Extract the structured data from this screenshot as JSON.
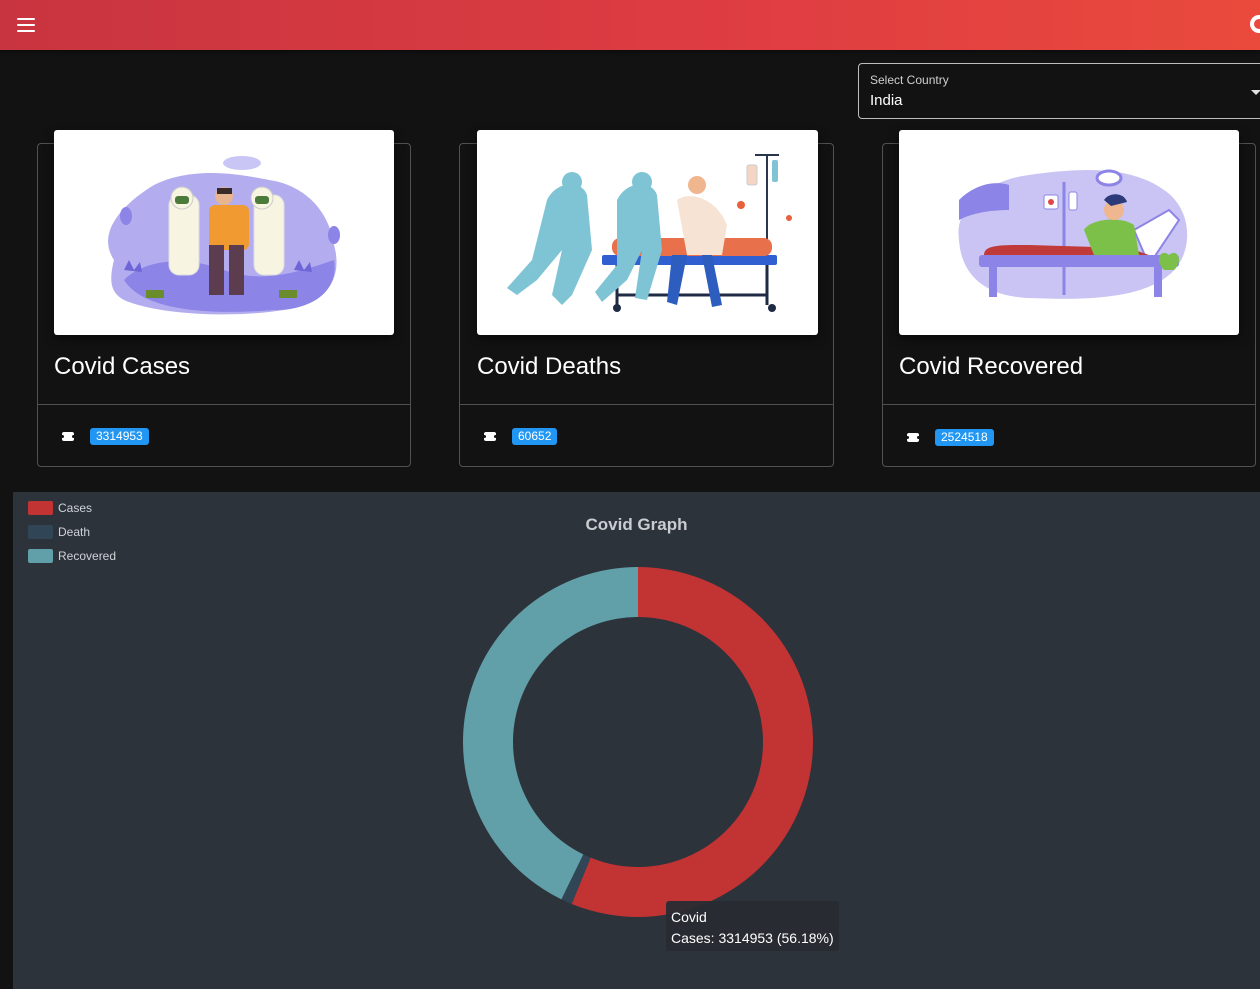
{
  "appbar": {
    "menu_icon": "menu-icon",
    "edge_icon": "refresh-icon"
  },
  "country_select": {
    "label": "Select Country",
    "value": "India"
  },
  "cards": [
    {
      "title": "Covid Cases",
      "count": "3314953",
      "icon": "ticket-icon"
    },
    {
      "title": "Covid Deaths",
      "count": "60652",
      "icon": "ticket-icon"
    },
    {
      "title": "Covid Recovered",
      "count": "2524518",
      "icon": "ticket-icon"
    }
  ],
  "graph": {
    "title": "Covid Graph",
    "legend": [
      "Cases",
      "Death",
      "Recovered"
    ],
    "tooltip_title": "Covid",
    "tooltip_body": "Cases: 3314953 (56.18%)"
  },
  "colors": {
    "cases": "#c23334",
    "death": "#304656",
    "recovered": "#61a0a8",
    "badge": "#2196f3"
  },
  "chart_data": {
    "type": "pie",
    "title": "Covid Graph",
    "categories": [
      "Cases",
      "Death",
      "Recovered"
    ],
    "values": [
      3314953,
      60652,
      2524518
    ],
    "legend": "top-left",
    "grid": false
  }
}
